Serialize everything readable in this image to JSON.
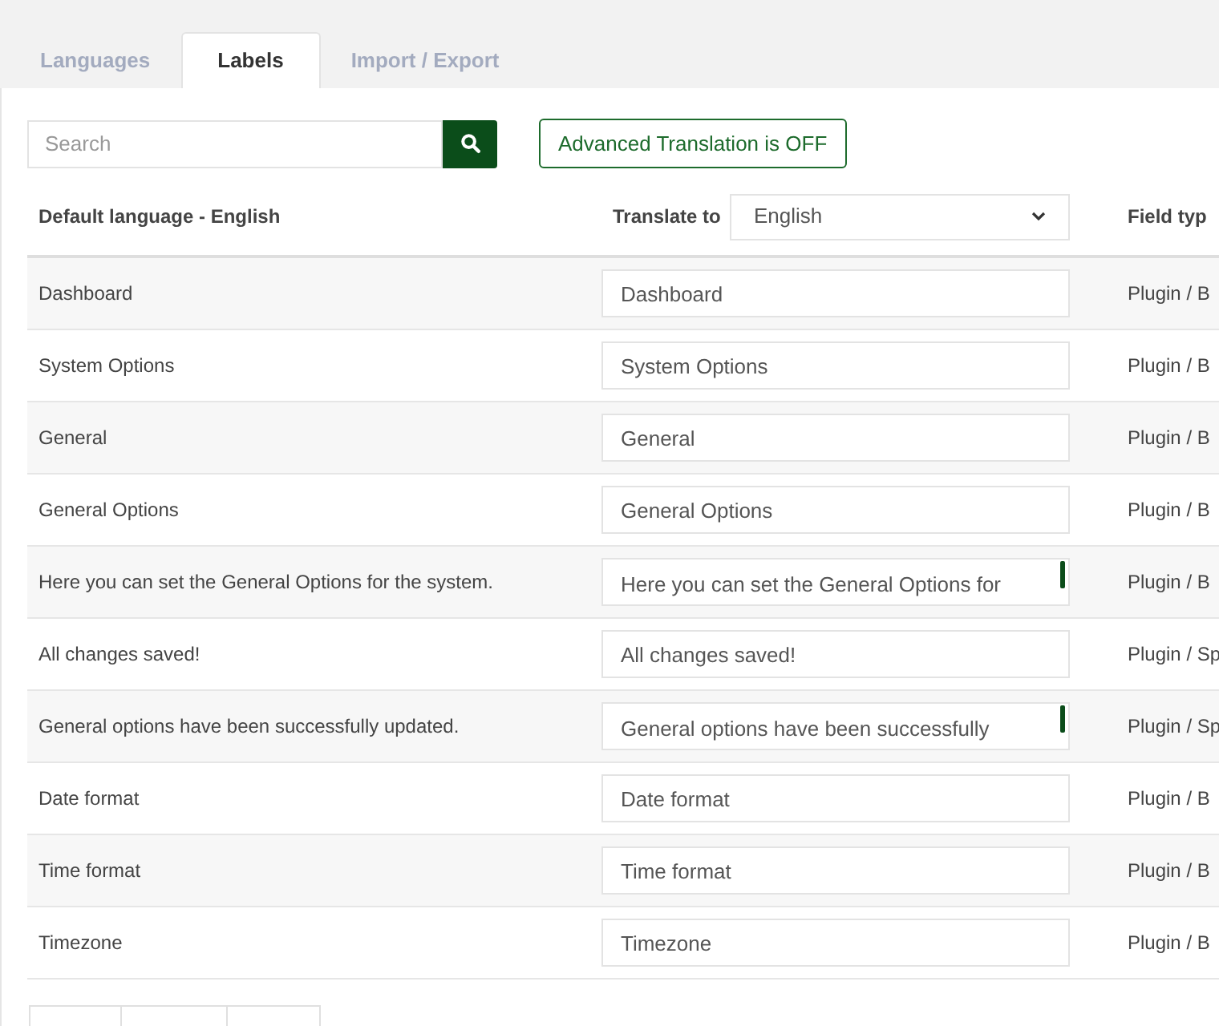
{
  "tabs": [
    {
      "label": "Languages",
      "selected": false
    },
    {
      "label": "Labels",
      "selected": true
    },
    {
      "label": "Import / Export",
      "selected": false
    }
  ],
  "search": {
    "placeholder": "Search"
  },
  "advanced_toggle": {
    "label": "Advanced Translation is OFF",
    "on": false
  },
  "table": {
    "columns": {
      "default": "Default language - English",
      "translate": "Translate to",
      "language_select": "English",
      "field_type": "Field typ"
    },
    "rows": [
      {
        "label": "Dashboard",
        "kind": "input",
        "translation": "Dashboard",
        "field_type": "Plugin / B"
      },
      {
        "label": "System Options",
        "kind": "input",
        "translation": "System Options",
        "field_type": "Plugin / B"
      },
      {
        "label": "General",
        "kind": "input",
        "translation": "General",
        "field_type": "Plugin / B"
      },
      {
        "label": "General Options",
        "kind": "input",
        "translation": "General Options",
        "field_type": "Plugin / B"
      },
      {
        "label": "Here you can set the General Options for the system.",
        "kind": "textarea",
        "translation": "Here you can set the General Options for",
        "field_type": "Plugin / B"
      },
      {
        "label": "All changes saved!",
        "kind": "input",
        "translation": "All changes saved!",
        "field_type": "Plugin / Sp"
      },
      {
        "label": "General options have been successfully updated.",
        "kind": "textarea",
        "translation": "General options have been successfully",
        "field_type": "Plugin / Sp"
      },
      {
        "label": "Date format",
        "kind": "input",
        "translation": "Date format",
        "field_type": "Plugin / B"
      },
      {
        "label": "Time format",
        "kind": "input",
        "translation": "Time format",
        "field_type": "Plugin / B"
      },
      {
        "label": "Timezone",
        "kind": "input",
        "translation": "Timezone",
        "field_type": "Plugin / B"
      }
    ]
  }
}
